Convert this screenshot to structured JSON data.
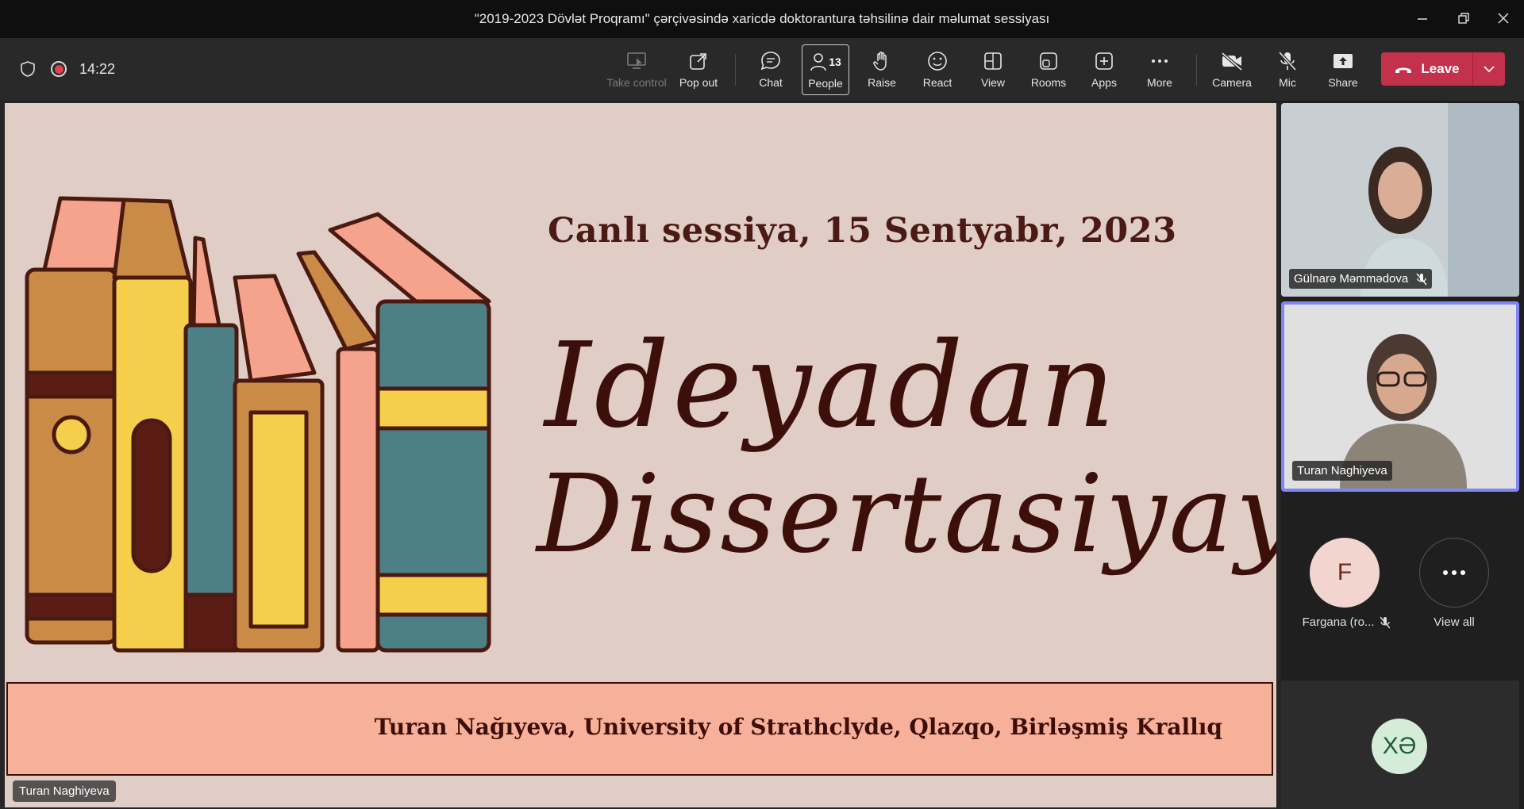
{
  "window": {
    "title": "\"2019-2023 Dövlət Proqramı\" çərçivəsində xaricdə doktorantura təhsilinə dair məlumat sessiyası"
  },
  "meeting": {
    "timer": "14:22"
  },
  "toolbar": {
    "take_control": "Take control",
    "pop_out": "Pop out",
    "chat": "Chat",
    "people": "People",
    "people_count": "13",
    "raise": "Raise",
    "react": "React",
    "view": "View",
    "rooms": "Rooms",
    "apps": "Apps",
    "more": "More",
    "camera": "Camera",
    "mic": "Mic",
    "share": "Share",
    "leave": "Leave"
  },
  "slide": {
    "date_line": "Canlı sessiya, 15 Sentyabr, 2023",
    "title_line1": "Ideyadan",
    "title_line2": "Dissertasiyaya",
    "author_line": "Turan Nağıyeva, University of Strathclyde, Qlazqo, Birləşmiş Krallıq",
    "presenter_tag": "Turan Naghiyeva"
  },
  "participants": {
    "tile1_name": "Gülnarə Məmmədova",
    "tile2_name": "Turan Naghiyeva",
    "avatar_f_initial": "F",
    "avatar_f_name": "Fargana (ro...",
    "view_all": "View all",
    "avatar_xe_initials": "XƏ"
  },
  "colors": {
    "leave": "#c4314b",
    "active_speaker_border": "#7f85f5",
    "slide_bg": "#e0cdc5",
    "slide_band": "#f7b09a",
    "slide_text": "#3d0f0a"
  }
}
